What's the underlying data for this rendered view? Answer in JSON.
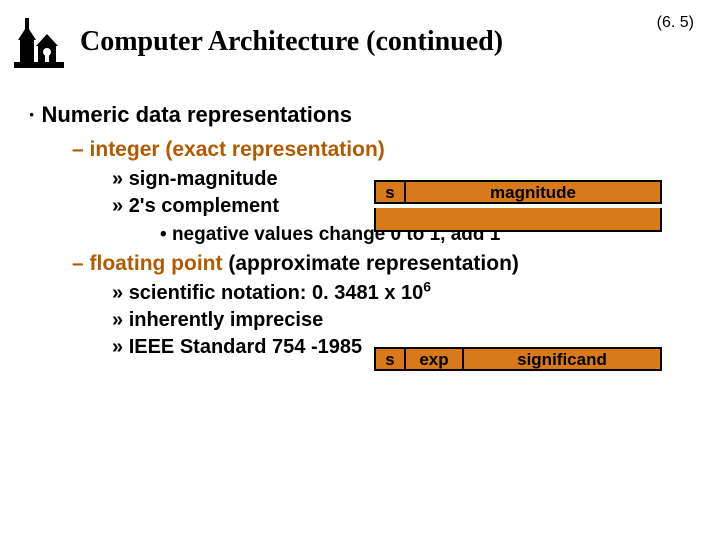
{
  "header": {
    "title": "Computer Architecture (continued)",
    "page_number": "(6. 5)"
  },
  "content": {
    "h1": "Numeric data representations",
    "int_header": "integer (exact representation)",
    "int_items": {
      "a": "sign-magnitude",
      "b": "2's complement",
      "b_sub": "negative values change 0 to 1, add 1"
    },
    "fp_header_pre": "floating point",
    "fp_header_post": " (approximate representation)",
    "fp_items": {
      "a_pre": "scientific notation:  0. 3481 x  10",
      "a_sup": "6",
      "b": "inherently imprecise",
      "c": "IEEE Standard 754 -1985"
    }
  },
  "diagrams": {
    "int": {
      "s": "s",
      "rest": "magnitude"
    },
    "fp": {
      "s": "s",
      "exp": "exp",
      "rest": "significand"
    }
  },
  "bullets": {
    "l1": "·",
    "l2": "–",
    "l3": "»",
    "l4": "•"
  }
}
